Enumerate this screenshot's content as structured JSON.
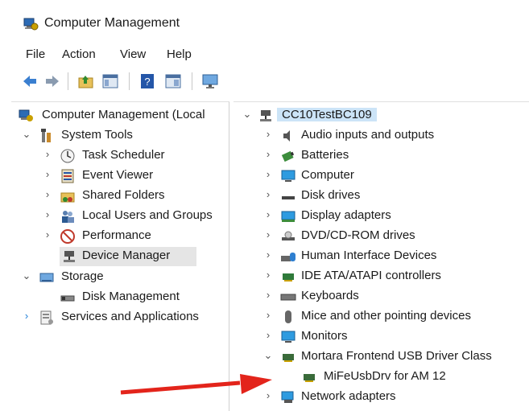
{
  "window": {
    "title": "Computer Management"
  },
  "menu": [
    "File",
    "Action",
    "View",
    "Help"
  ],
  "toolbar": {
    "icons": [
      "back-arrow-icon",
      "forward-arrow-icon",
      "folder-up-icon",
      "console-tree-icon",
      "help-icon",
      "properties-icon",
      "monitor-icon"
    ]
  },
  "left_tree": {
    "root": "Computer Management (Local",
    "system_tools": "System Tools",
    "task_scheduler": "Task Scheduler",
    "event_viewer": "Event Viewer",
    "shared_folders": "Shared Folders",
    "local_users": "Local Users and Groups",
    "performance": "Performance",
    "device_manager": "Device Manager",
    "storage": "Storage",
    "disk_management": "Disk Management",
    "services_apps": "Services and Applications"
  },
  "right_tree": {
    "computer_name": "CC10TestBC109",
    "categories": [
      "Audio inputs and outputs",
      "Batteries",
      "Computer",
      "Disk drives",
      "Display adapters",
      "DVD/CD-ROM drives",
      "Human Interface Devices",
      "IDE ATA/ATAPI controllers",
      "Keyboards",
      "Mice and other pointing devices",
      "Monitors",
      "Mortara Frontend USB Driver Class"
    ],
    "child_device": "MiFeUsbDrv for AM 12",
    "after_child": "Network adapters"
  },
  "colors": {
    "accent_arrow": "#e3241b",
    "selection": "#e5e5e5",
    "root_selection": "#cce4f7"
  }
}
